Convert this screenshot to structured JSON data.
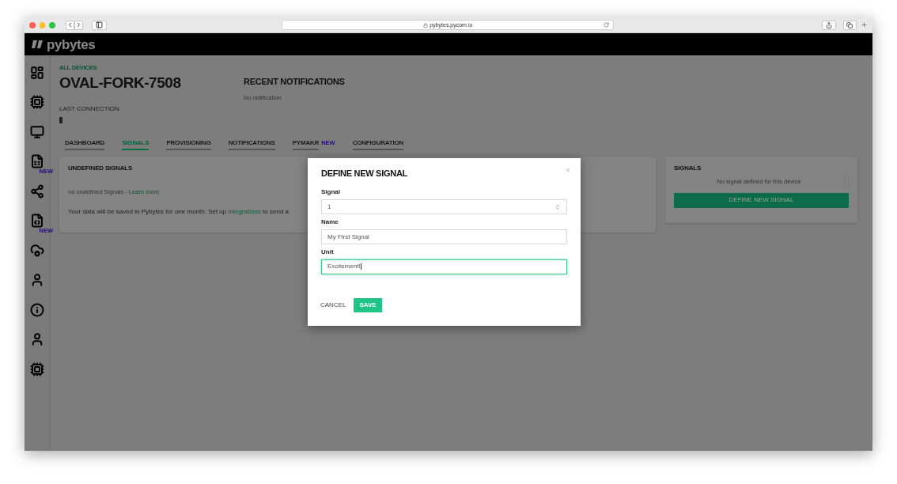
{
  "browser": {
    "url": "pybytes.pycom.io"
  },
  "app": {
    "logo": "pybytes"
  },
  "sidebar": {
    "items": [
      {
        "kind": "dashboard"
      },
      {
        "kind": "chip"
      },
      {
        "kind": "monitor"
      },
      {
        "kind": "sim",
        "badge": "NEW"
      },
      {
        "kind": "network"
      },
      {
        "kind": "code",
        "badge": "NEW"
      },
      {
        "kind": "cloud"
      },
      {
        "kind": "user"
      },
      {
        "kind": "info"
      },
      {
        "kind": "user"
      },
      {
        "kind": "chip"
      }
    ]
  },
  "device": {
    "breadcrumb": "ALL DEVICES",
    "name": "OVAL-FORK-7508",
    "last_connection_label": "LAST CONNECTION"
  },
  "recent_notifications": {
    "title": "RECENT NOTIFICATIONS",
    "empty": "No notification"
  },
  "tabs": [
    {
      "label": "DASHBOARD",
      "selected": false
    },
    {
      "label": "SIGNALS",
      "selected": true
    },
    {
      "label": "PROVISIONING",
      "selected": false
    },
    {
      "label": "NOTIFICATIONS",
      "selected": false
    },
    {
      "label": "PYMAKR",
      "selected": false,
      "badge": "NEW"
    },
    {
      "label": "CONFIGURATION",
      "selected": false
    }
  ],
  "undefined_signals": {
    "title": "UNDEFINED SIGNALS",
    "empty": "no undefined Signals - ",
    "empty_link": "Learn more",
    "note": "Your data will be saved in Pybytes for one month. Set up ",
    "note_link": "integrations",
    "note_tail": " to send a"
  },
  "signals_panel": {
    "title": "SIGNALS",
    "empty": "No signal defined for this device",
    "button": "DEFINE NEW SIGNAL"
  },
  "modal": {
    "title": "DEFINE NEW SIGNAL",
    "close": "×",
    "fields": [
      {
        "label": "Signal",
        "value": "1",
        "kind": "number",
        "focused": false
      },
      {
        "label": "Name",
        "value": "My First Signal",
        "kind": "text",
        "focused": false
      },
      {
        "label": "Unit",
        "value": "Excitement!",
        "kind": "text",
        "focused": true
      }
    ],
    "cancel": "CANCEL",
    "save": "SAVE"
  }
}
